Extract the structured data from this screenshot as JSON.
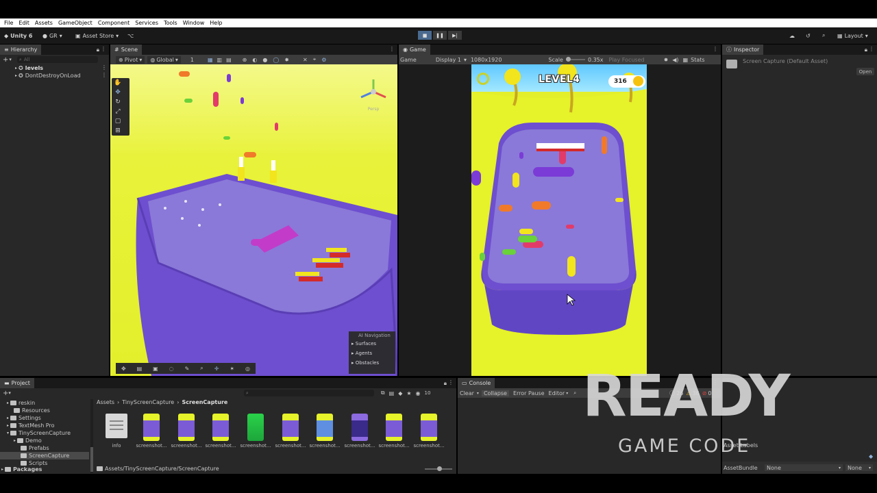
{
  "menu": [
    "File",
    "Edit",
    "Assets",
    "GameObject",
    "Component",
    "Services",
    "Tools",
    "Window",
    "Help"
  ],
  "toolbar": {
    "unity": "Unity 6",
    "account": "GR",
    "asset_store": "Asset Store",
    "layout": "Layout"
  },
  "hierarchy": {
    "title": "Hierarchy",
    "search": "All",
    "items": [
      "levels",
      "DontDestroyOnLoad"
    ]
  },
  "scene": {
    "title": "Scene",
    "pivot": "Pivot",
    "global": "Global",
    "num": "1",
    "persp": "Persp",
    "ai_nav": {
      "title": "AI Navigation",
      "items": [
        "Surfaces",
        "Agents",
        "Obstacles"
      ]
    }
  },
  "game": {
    "title": "Game",
    "mode": "Game",
    "display": "Display 1",
    "resolution": "1080x1920",
    "scale_label": "Scale",
    "scale": "0.35x",
    "play_focused": "Play Focused",
    "stats": "Stats",
    "level": "LEVEL4",
    "coins": "316"
  },
  "inspector": {
    "title": "Inspector",
    "asset": "Screen Capture (Default Asset)",
    "open": "Open",
    "asset_labels": "Asset Labels",
    "asset_bundle": "AssetBundle",
    "none1": "None",
    "none2": "None"
  },
  "project": {
    "title": "Project",
    "tree": [
      "reskin",
      "Resources",
      "Settings",
      "TextMesh Pro",
      "TinyScreenCapture",
      "Demo",
      "Prefabs",
      "ScreenCapture",
      "Scripts",
      "Packages"
    ],
    "breadcrumb": [
      "Assets",
      "TinyScreenCapture",
      "ScreenCapture"
    ],
    "files": [
      "info",
      "screenshot...",
      "screenshot...",
      "screenshot...",
      "screenshot...",
      "screenshot...",
      "screenshot...",
      "screenshot...",
      "screenshot...",
      "screenshot..."
    ],
    "path": "Assets/TinyScreenCapture/ScreenCapture",
    "count": "10"
  },
  "console": {
    "title": "Console",
    "clear": "Clear",
    "collapse": "Collapse",
    "error_pause": "Error Pause",
    "editor": "Editor",
    "c1": "26",
    "c2": "36",
    "c3": "0"
  },
  "watermark": {
    "ready": "READY",
    "sub": "GAME CODE"
  },
  "colors": {
    "panel": "#282828",
    "tab": "#3c3c3c",
    "yellow": "#e6f22a",
    "purple": "#7b5cd6",
    "blue_sel": "#2c5d87"
  }
}
